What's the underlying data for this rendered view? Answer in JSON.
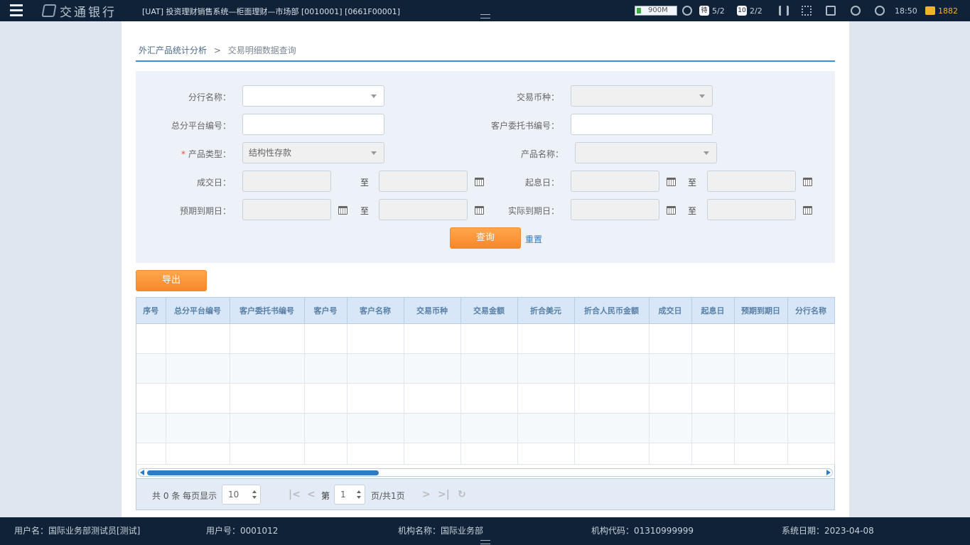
{
  "topbar": {
    "bank_name": "交通银行",
    "sys_title": "[UAT] 投资理财销售系统—柜面理财—市场部 [0010001]  [0661F00001]",
    "signal_text": "900M",
    "badge1": "待",
    "badge1_count": "5/2",
    "badge2": "10",
    "badge2_count": "2/2",
    "time": "18:50",
    "msg_count": "1882"
  },
  "breadcrumb": {
    "parent": "外汇产品统计分析",
    "separator": ">",
    "current": "交易明细数据查询"
  },
  "form": {
    "branch_label": "分行名称：",
    "trade_currency_label": "交易币种：",
    "total_contract_label": "总分平台编号：",
    "customer_contract_label": "客户委托书编号：",
    "product_type_label": "产品类型：",
    "product_type_required": "*",
    "product_type_value": "结构性存款",
    "product_name_label": "产品名称：",
    "trade_date_label": "成交日：",
    "value_date_label": "起息日：",
    "expiry_date_label": "预期到期日：",
    "actual_expiry_label": "实际到期日：",
    "to1": "至",
    "to2": "至",
    "to3": "至",
    "to4": "至",
    "query_button": "查询",
    "reset_link": "重置"
  },
  "export_button": "导出",
  "table": {
    "columns": [
      "序号",
      "总分平台编号",
      "客户委托书编号",
      "客户号",
      "客户名称",
      "交易币种",
      "交易金额",
      "折合美元",
      "折合人民币金额",
      "成交日",
      "起息日",
      "预期到期日",
      "分行名称"
    ],
    "rows": [
      [],
      [],
      [],
      [],
      []
    ]
  },
  "pager": {
    "total_prefix": "共",
    "total_count": "0",
    "total_suffix": "条 每页显示",
    "page_size": "10",
    "page_prefix": "第",
    "page_num": "1",
    "page_suffix": "页/共1页"
  },
  "bottombar": {
    "user_name": "用户名：国际业务部测试员[测试]",
    "user_id": "用户号：0001012",
    "org_name": "机构名称：国际业务部",
    "org_code": "机构代码：01310999999",
    "system_date": "系统日期：2023-04-08"
  }
}
